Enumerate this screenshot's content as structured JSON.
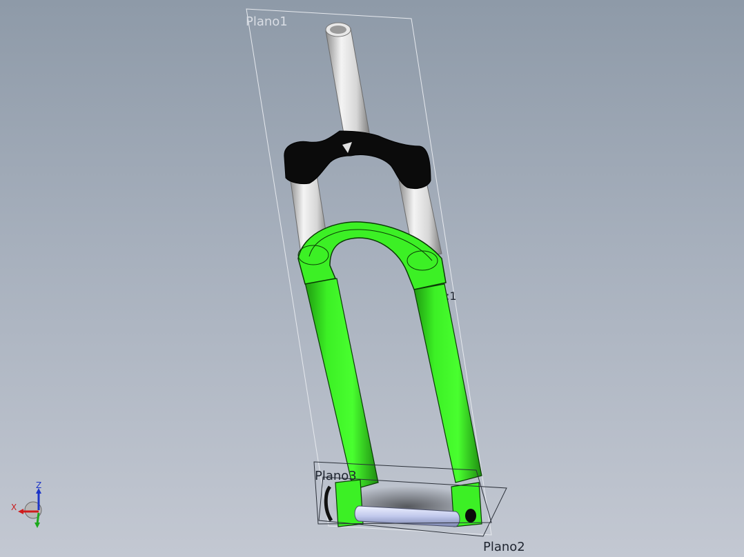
{
  "planes": {
    "plano1": "Plano1",
    "plano2": "Plano2",
    "plano3": "Plano3",
    "fragment": ":1"
  },
  "triad": {
    "z": "Z",
    "x": "X"
  },
  "colors": {
    "lower_legs": "#3cf025",
    "lower_legs_shade": "#1fa00f",
    "crown": "#0b0b0b",
    "stanchions": "#dcdcdc",
    "axle": "#c8d0ee"
  }
}
